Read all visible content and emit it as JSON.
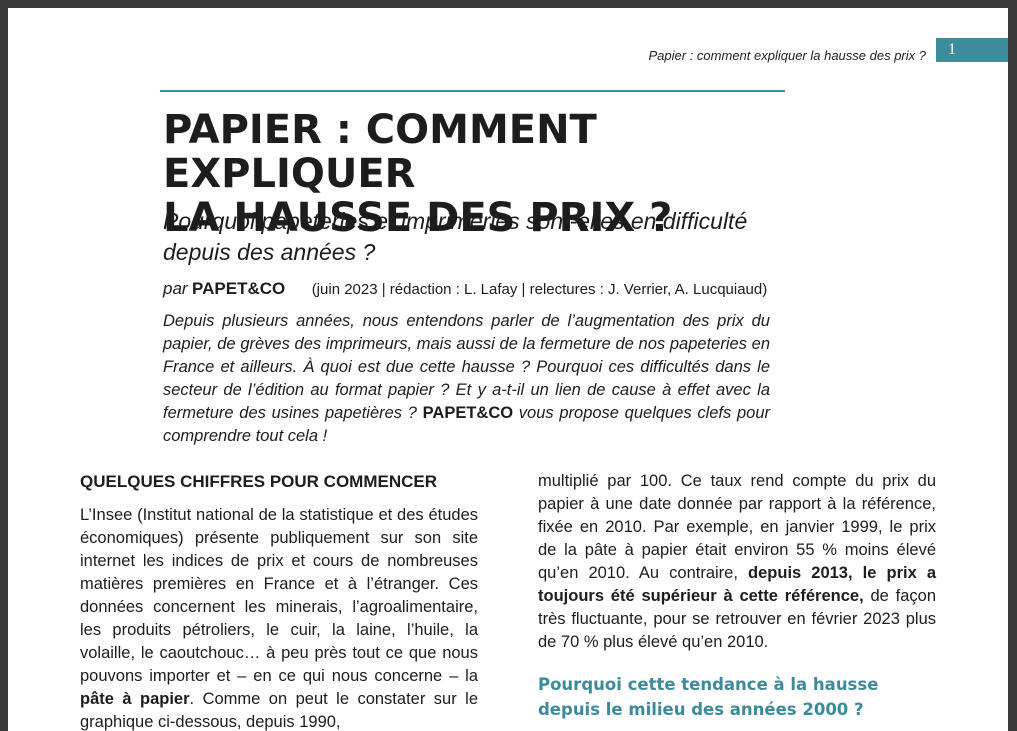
{
  "header": {
    "running_title": "Papier : comment expliquer la hausse des prix ?",
    "page_number": "1"
  },
  "article": {
    "title_line1": "PAPIER : COMMENT EXPLIQUER",
    "title_line2": "LA HAUSSE DES PRIX ?",
    "subtitle": "Pourquoi papeteries et imprimeries sont-elles en difficulté depuis des années ?",
    "byline_prefix": "par",
    "byline_author": "PAPET&CO",
    "byline_meta": "(juin 2023 | rédaction : L. Lafay | relectures : J. Verrier, A. Lucquiaud)",
    "lede_part1": "Depuis plusieurs années, nous entendons parler de l’augmentation des prix du papier, de grèves des imprimeurs, mais aussi de la fermeture de nos papeteries en France et ailleurs. À quoi est due cette hausse ? Pourquoi ces difficultés dans le secteur de l’édition au format papier ? Et y a-t-il un lien de cause à effet avec la fermeture des usines papetières ?",
    "lede_brand": "PAPET&CO",
    "lede_part2": "vous propose quelques clefs pour comprendre tout cela !"
  },
  "left_column": {
    "heading": "QUELQUES CHIFFRES POUR COMMENCER",
    "para_part1": "L’Insee (Institut national de la statistique et des études économiques) présente publiquement sur son site internet les indices de prix et cours de nombreuses matières premières en France et à l’étranger. Ces données concernent les minerais, l’agroalimentaire, les produits pétroliers, le cuir, la laine, l’huile, la volaille, le caoutchouc… à peu près tout ce que nous pouvons importer et – en ce qui nous concerne – la",
    "para_bold": "pâte à papier",
    "para_part2": ". Comme on peut le constater sur le graphique ci-dessous, depuis 1990,"
  },
  "right_column": {
    "para_part1": "multiplié par 100. Ce taux rend compte du prix du papier à une date donnée par rapport à la référence, fixée en 2010. Par exemple, en janvier 1999, le prix de la pâte à papier était environ 55 % moins élevé qu’en 2010. Au contraire,",
    "para_bold": "depuis 2013, le prix a toujours été supérieur à cette référence,",
    "para_part2": "de façon très fluctuante, pour se retrouver en février 2023 plus de 70 % plus élevé qu’en 2010.",
    "subheading": "Pourquoi cette tendance à la hausse depuis le milieu des années 2000 ?"
  },
  "colors": {
    "accent": "#3c8b9a",
    "text": "#1d1d1d",
    "background": "#3a3a3a"
  }
}
